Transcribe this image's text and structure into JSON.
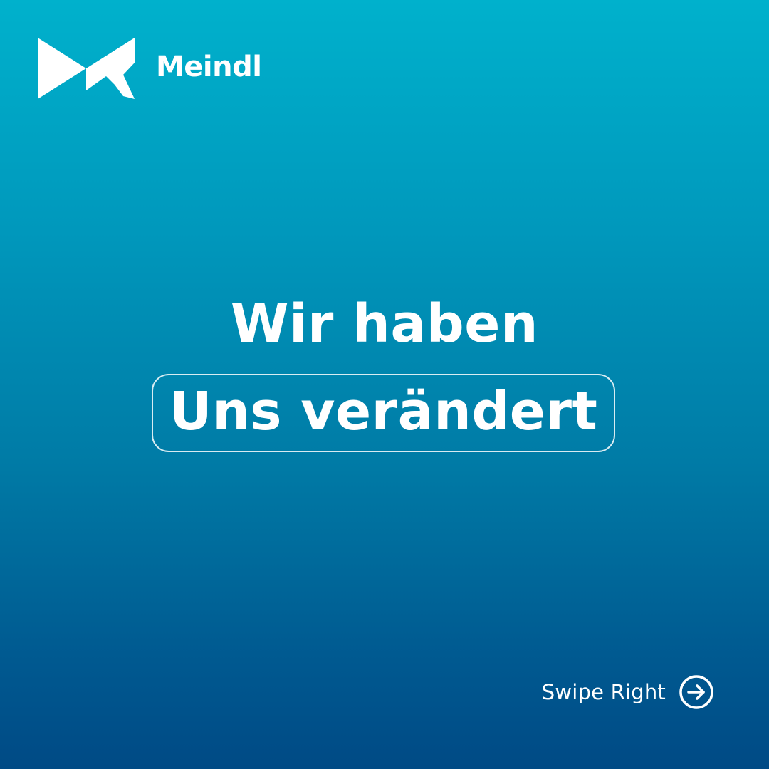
{
  "brand": {
    "name": "Meindl",
    "logo_icon": "meindl-m-logo"
  },
  "headline": {
    "line1": "Wir haben",
    "line2": "Uns verändert"
  },
  "navigation": {
    "swipe_label": "Swipe Right",
    "swipe_icon": "arrow-right-circle-icon"
  },
  "colors": {
    "gradient_top": "#00b1cc",
    "gradient_bottom": "#004a85",
    "text": "#ffffff"
  }
}
